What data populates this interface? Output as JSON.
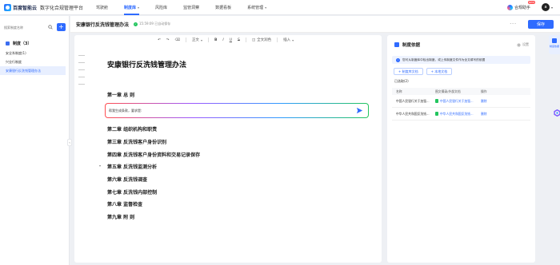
{
  "app": {
    "logo_text": "百度智能云",
    "platform_name": "数字化合规管理平台"
  },
  "nav": {
    "items": [
      {
        "label": "驾驶舱",
        "active": false,
        "dropdown": false
      },
      {
        "label": "制度库",
        "active": true,
        "dropdown": true
      },
      {
        "label": "风险库",
        "active": false,
        "dropdown": false
      },
      {
        "label": "监管洞察",
        "active": false,
        "dropdown": false
      },
      {
        "label": "数据看板",
        "active": false,
        "dropdown": false
      },
      {
        "label": "系统管理",
        "active": false,
        "dropdown": true
      }
    ]
  },
  "topbar": {
    "assistant_label": "合规助手",
    "assistant_badge": "NEW",
    "avatar_initial": "a"
  },
  "sidebar": {
    "search_placeholder": "搜索制度名称",
    "add_label": "+",
    "group_title": "制度（3）",
    "items": [
      {
        "label": "安全系制度(1)",
        "active": false
      },
      {
        "label": "兴业行制度",
        "active": false
      },
      {
        "label": "安康银行反洗钱管理办法",
        "active": true
      }
    ],
    "collapse_glyph": "‹"
  },
  "doc": {
    "title": "安康银行反洗钱管理办法",
    "saved_status": "15:59:09 已自动保存",
    "more": "···",
    "save_label": "保存"
  },
  "toolbar": {
    "undo": "↶",
    "redo": "↷",
    "format_paint": "⌫",
    "style": "正文",
    "bold": "B",
    "italic": "I",
    "underline": "U",
    "strike": "S",
    "fullscreen": "全文润色",
    "insert": "插入"
  },
  "editor": {
    "heading": "安康银行反洗钱管理办法",
    "chapters": [
      "第一章 总 则",
      "第二章 组织机构和职责",
      "第三章 反洗钱客户身份识别",
      "第四章 反洗钱客户身份资料和交易记录保存",
      "第五章 反洗钱监测分析",
      "第六章 反洗钱调查",
      "第七章 反洗钱内部控制",
      "第八章 监督检查",
      "第九章 附 则"
    ],
    "ai_prompt": "帮我生成条款，要求是:"
  },
  "basis_panel": {
    "title": "制度依据",
    "settings": "设置",
    "info": "您可从制度库中检出制度，或上传制度文件作为全文填写的依据",
    "buttons": [
      "+ 制度库文档",
      "+ 本地文档"
    ],
    "count": "已选取(2)",
    "columns": [
      "名称",
      "图文摘录/外部文档",
      "操作"
    ],
    "rows": [
      {
        "name": "中国人民银行关于加强...",
        "source": "中国人民银行关于加强...",
        "action": "删除"
      },
      {
        "name": "中华人民共和国反洗钱...",
        "source": "中华人民共和国反洗钱...",
        "action": "删除"
      }
    ]
  },
  "rail": {
    "label": "制度依据"
  },
  "colors": {
    "accent": "#2f6bff",
    "success": "#22c55e"
  }
}
